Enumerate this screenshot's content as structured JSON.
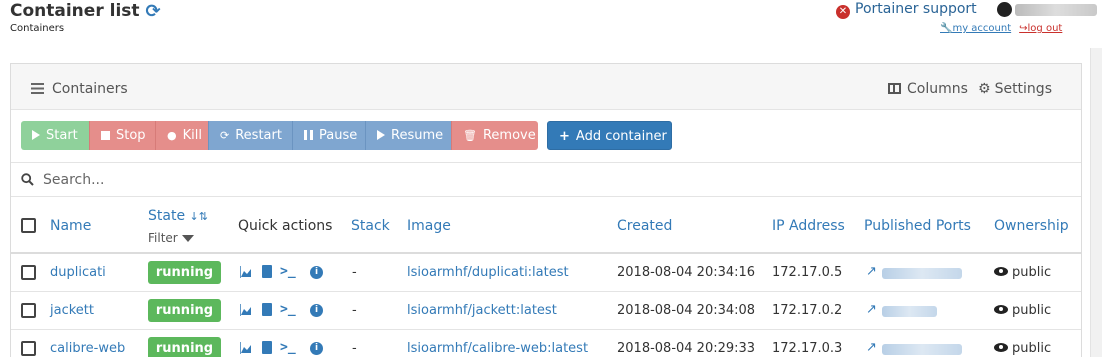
{
  "header": {
    "title": "Container list",
    "subtitle": "Containers",
    "support_label": "Portainer support",
    "my_account_label": "my account",
    "logout_label": "log out"
  },
  "widget": {
    "title": "Containers",
    "columns_label": "Columns",
    "settings_label": "Settings"
  },
  "toolbar": {
    "start": "Start",
    "stop": "Stop",
    "kill": "Kill",
    "restart": "Restart",
    "pause": "Pause",
    "resume": "Resume",
    "remove": "Remove",
    "add_container": "Add container"
  },
  "search": {
    "placeholder": "Search..."
  },
  "table": {
    "headers": {
      "name": "Name",
      "state": "State",
      "filter": "Filter",
      "quick_actions": "Quick actions",
      "stack": "Stack",
      "image": "Image",
      "created": "Created",
      "ip": "IP Address",
      "ports": "Published Ports",
      "ownership": "Ownership"
    },
    "rows": [
      {
        "name": "duplicati",
        "state": "running",
        "stack": "-",
        "image": "lsioarmhf/duplicati:latest",
        "created": "2018-08-04 20:34:16",
        "ip": "172.17.0.5",
        "ownership": "public"
      },
      {
        "name": "jackett",
        "state": "running",
        "stack": "-",
        "image": "lsioarmhf/jackett:latest",
        "created": "2018-08-04 20:34:08",
        "ip": "172.17.0.2",
        "ownership": "public"
      },
      {
        "name": "calibre-web",
        "state": "running",
        "stack": "-",
        "image": "lsioarmhf/calibre-web:latest",
        "created": "2018-08-04 20:29:33",
        "ip": "172.17.0.3",
        "ownership": "public"
      }
    ]
  },
  "colors": {
    "link": "#337ab7",
    "success": "#5cb85c",
    "danger": "#e58e8b",
    "primary": "#337ab7"
  }
}
